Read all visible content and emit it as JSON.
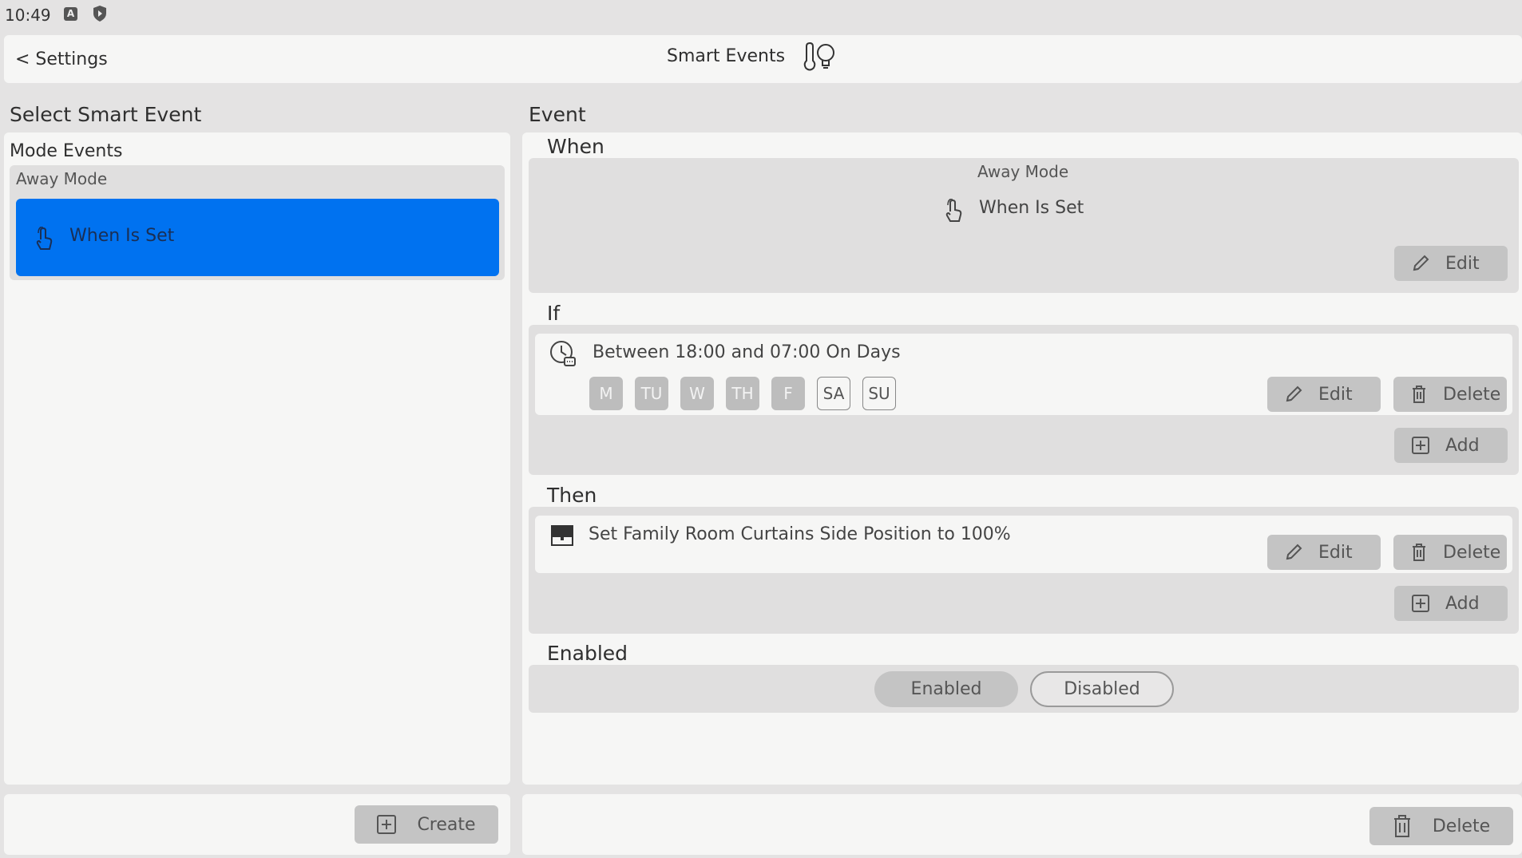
{
  "status_bar": {
    "time": "10:49",
    "icons": [
      "a-indicator-icon",
      "shield-play-icon"
    ]
  },
  "header": {
    "back_label": "< Settings",
    "title": "Smart Events",
    "title_icon": "thermometer-bulb-icon"
  },
  "left": {
    "title": "Select Smart Event",
    "group_label": "Mode Events",
    "mode_name": "Away Mode",
    "selected_item": "When Is Set",
    "create_label": "Create"
  },
  "right": {
    "title": "Event",
    "when": {
      "title": "When",
      "mode": "Away Mode",
      "trigger": "When Is Set",
      "edit_label": "Edit"
    },
    "if": {
      "title": "If",
      "condition": "Between 18:00 and 07:00 On Days",
      "days": [
        {
          "label": "M",
          "active": true
        },
        {
          "label": "TU",
          "active": true
        },
        {
          "label": "W",
          "active": true
        },
        {
          "label": "TH",
          "active": true
        },
        {
          "label": "F",
          "active": true
        },
        {
          "label": "SA",
          "active": false
        },
        {
          "label": "SU",
          "active": false
        }
      ],
      "edit_label": "Edit",
      "delete_label": "Delete",
      "add_label": "Add"
    },
    "then": {
      "title": "Then",
      "action": "Set Family Room Curtains Side Position to 100%",
      "edit_label": "Edit",
      "delete_label": "Delete",
      "add_label": "Add"
    },
    "enabled": {
      "title": "Enabled",
      "enabled_label": "Enabled",
      "disabled_label": "Disabled",
      "state": "Enabled"
    },
    "delete_label": "Delete"
  },
  "colors": {
    "selected": "#0072f0",
    "panel": "#f6f6f5",
    "background": "#e4e3e3",
    "button": "#c4c4c4"
  }
}
